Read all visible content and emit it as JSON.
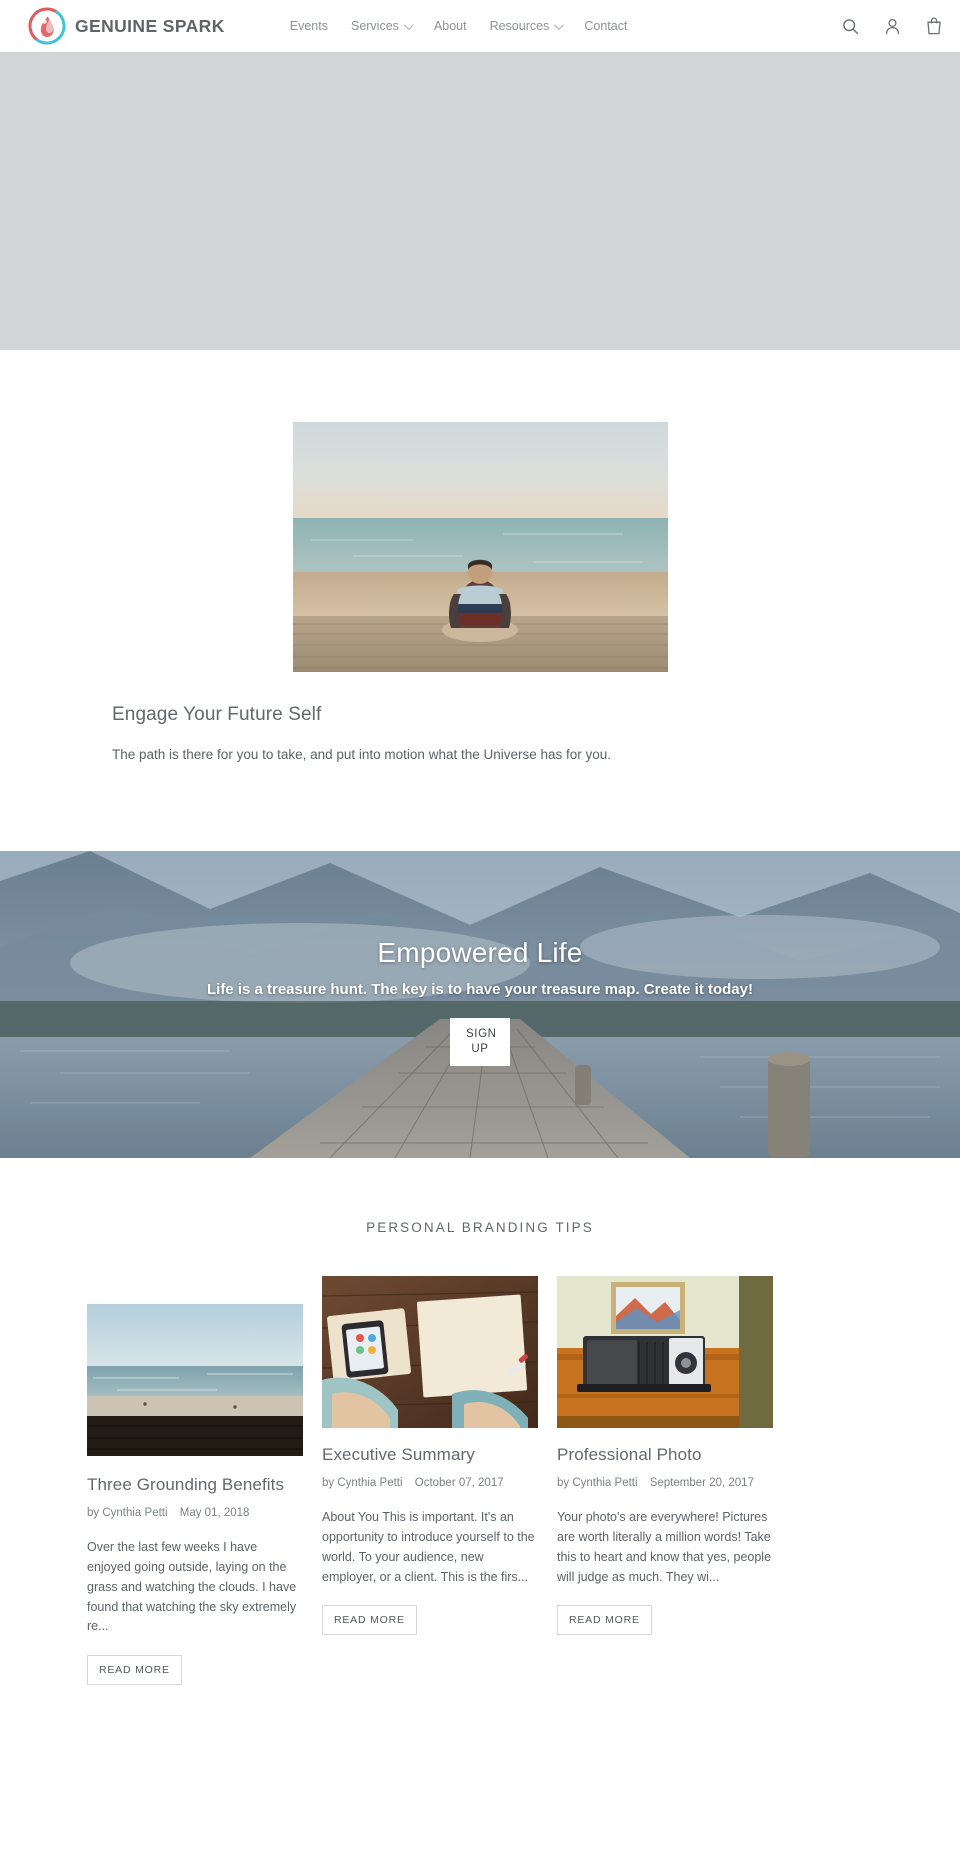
{
  "header": {
    "brand_name": "GENUINE SPARK",
    "logo_icon": "flame-droplet-logo",
    "logo_colors": {
      "red": "#e05c5c",
      "cyan": "#3fc1d6"
    },
    "nav": [
      {
        "label": "Events",
        "has_dropdown": false
      },
      {
        "label": "Services",
        "has_dropdown": true
      },
      {
        "label": "About",
        "has_dropdown": false
      },
      {
        "label": "Resources",
        "has_dropdown": true
      },
      {
        "label": "Contact",
        "has_dropdown": false
      }
    ],
    "actions": [
      {
        "icon": "search-icon",
        "label": "Search"
      },
      {
        "icon": "account-icon",
        "label": "Log in"
      },
      {
        "icon": "cart-icon",
        "label": "Cart"
      }
    ]
  },
  "feature": {
    "image_alt": "man-sitting-on-dock-facing-ocean",
    "title": "Engage Your Future Self",
    "body": "The path is there for you to take, and put into motion what the Universe has for you."
  },
  "banner": {
    "image_alt": "wooden-pier-on-mountain-lake",
    "title": "Empowered Life",
    "subtitle": "Life is a treasure hunt. The key is to have your treasure map. Create it today!",
    "button_label": "SIGN UP"
  },
  "blog": {
    "heading": "PERSONAL BRANDING TIPS",
    "read_more_label": "READ MORE",
    "author_prefix": "by",
    "posts": [
      {
        "title": "Three Grounding Benefits",
        "author": "by Cynthia Petti",
        "date": "May 01, 2018",
        "excerpt": "Over the last few weeks I have enjoyed going outside, laying on the grass and watching the clouds. I have found that watching the sky extremely re...",
        "image_alt": "beach-shoreline-with-dark-wooden-wall"
      },
      {
        "title": "Executive Summary",
        "author": "by Cynthia Petti",
        "date": "October 07, 2017",
        "excerpt": "About You This is important. It's an opportunity to introduce yourself to the world.  To your audience, new employer, or a client. This is the firs...",
        "image_alt": "person-writing-in-notebook-with-phone-on-wooden-desk"
      },
      {
        "title": "Professional Photo",
        "author": "by Cynthia Petti",
        "date": "September 20, 2017",
        "excerpt": "Your photo's are everywhere! Pictures are worth literally a million words! Take this to heart and know that yes, people will judge as much. They wi...",
        "image_alt": "vintage-bellows-camera-on-wooden-cabinet"
      }
    ]
  },
  "colors": {
    "placeholder_grey": "#d2d4d6",
    "text_grey": "#63686c",
    "muted_grey": "#8d9296"
  }
}
